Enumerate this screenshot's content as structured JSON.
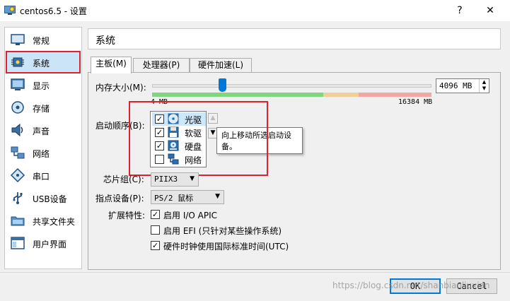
{
  "window": {
    "title": "centos6.5 - 设置",
    "help_label": "?",
    "close_label": "✕",
    "icon": "virtualbox-settings-icon"
  },
  "sidebar": {
    "items": [
      {
        "label": "常规",
        "icon": "general-icon"
      },
      {
        "label": "系统",
        "icon": "system-chip-icon",
        "selected": true
      },
      {
        "label": "显示",
        "icon": "display-icon"
      },
      {
        "label": "存储",
        "icon": "storage-icon"
      },
      {
        "label": "声音",
        "icon": "audio-icon"
      },
      {
        "label": "网络",
        "icon": "network-icon"
      },
      {
        "label": "串口",
        "icon": "serial-port-icon"
      },
      {
        "label": "USB设备",
        "icon": "usb-icon"
      },
      {
        "label": "共享文件夹",
        "icon": "shared-folder-icon"
      },
      {
        "label": "用户界面",
        "icon": "user-interface-icon"
      }
    ]
  },
  "header": {
    "title": "系统"
  },
  "tabs": [
    {
      "label": "主板(M)",
      "active": true
    },
    {
      "label": "处理器(P)"
    },
    {
      "label": "硬件加速(L)"
    }
  ],
  "motherboard": {
    "memory": {
      "label": "内存大小(M):",
      "value": "4096 MB",
      "min_label": "4 MB",
      "max_label": "16384 MB",
      "value_mb": 4096,
      "max_mb": 16384
    },
    "boot_order": {
      "label": "启动顺序(B):",
      "items": [
        {
          "label": "光驱",
          "checked": true,
          "icon": "optical-disc-icon"
        },
        {
          "label": "软驱",
          "checked": true,
          "icon": "floppy-icon"
        },
        {
          "label": "硬盘",
          "checked": true,
          "icon": "hard-disk-icon"
        },
        {
          "label": "网络",
          "checked": false,
          "icon": "network-icon"
        }
      ],
      "tooltip": "向上移动所选启动设备。"
    },
    "chipset": {
      "label": "芯片组(C):",
      "value": "PIIX3"
    },
    "pointing_device": {
      "label": "指点设备(P):",
      "value": "PS/2 鼠标"
    },
    "features": {
      "label": "扩展特性:",
      "items": [
        {
          "label": "启用 I/O APIC",
          "checked": true
        },
        {
          "label": "启用 EFI (只针对某些操作系统)",
          "checked": false
        },
        {
          "label": "硬件时钟使用国际标准时间(UTC)",
          "checked": true
        }
      ]
    }
  },
  "footer": {
    "ok_label": "OK",
    "cancel_label": "Cancel",
    "watermark": "https://blog.csdn.net/shanbiaoliuxian"
  },
  "colors": {
    "selection_outline": "#e0202a",
    "accent": "#0078d7",
    "slider_safe": "#7fd67f",
    "slider_warn": "#f0d09a",
    "slider_danger": "#f2a7a7"
  }
}
